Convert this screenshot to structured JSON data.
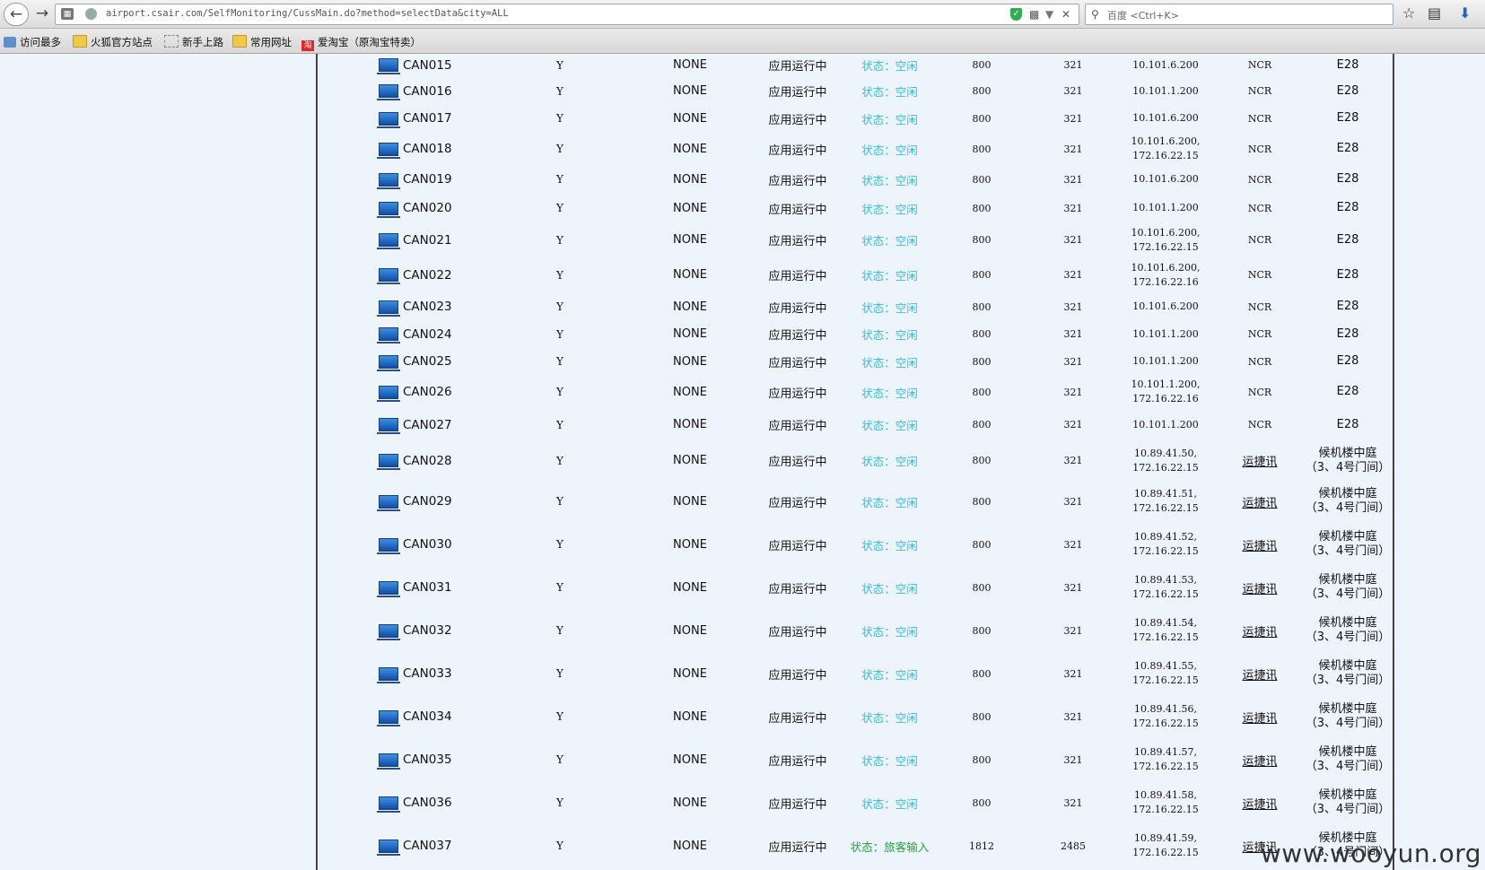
{
  "browser": {
    "url": "airport.csair.com/SelfMonitoring/CussMain.do?method=selectData&city=ALL",
    "search_placeholder": "百度 <Ctrl+K>"
  },
  "bookmarks": [
    "访问最多",
    "火狐官方站点",
    "新手上路",
    "常用网址",
    "爱淘宝（原淘宝特卖）"
  ],
  "rows": [
    {
      "name": "CAN015",
      "f1": "Y",
      "f2": "NONE",
      "app": "应用运行中",
      "status": "状态：空闲",
      "n1": "800",
      "n2": "321",
      "ip": [
        "10.101.6.200"
      ],
      "vendor": "NCR",
      "loc": [
        "E28"
      ]
    },
    {
      "name": "CAN016",
      "f1": "Y",
      "f2": "NONE",
      "app": "应用运行中",
      "status": "状态：空闲",
      "n1": "800",
      "n2": "321",
      "ip": [
        "10.101.1.200"
      ],
      "vendor": "NCR",
      "loc": [
        "E28"
      ]
    },
    {
      "name": "CAN017",
      "f1": "Y",
      "f2": "NONE",
      "app": "应用运行中",
      "status": "状态：空闲",
      "n1": "800",
      "n2": "321",
      "ip": [
        "10.101.6.200"
      ],
      "vendor": "NCR",
      "loc": [
        "E28"
      ]
    },
    {
      "name": "CAN018",
      "f1": "Y",
      "f2": "NONE",
      "app": "应用运行中",
      "status": "状态：空闲",
      "n1": "800",
      "n2": "321",
      "ip": [
        "10.101.6.200,",
        "172.16.22.15"
      ],
      "vendor": "NCR",
      "loc": [
        "E28"
      ]
    },
    {
      "name": "CAN019",
      "f1": "Y",
      "f2": "NONE",
      "app": "应用运行中",
      "status": "状态：空闲",
      "n1": "800",
      "n2": "321",
      "ip": [
        "10.101.6.200"
      ],
      "vendor": "NCR",
      "loc": [
        "E28"
      ]
    },
    {
      "name": "CAN020",
      "f1": "Y",
      "f2": "NONE",
      "app": "应用运行中",
      "status": "状态：空闲",
      "n1": "800",
      "n2": "321",
      "ip": [
        "10.101.1.200"
      ],
      "vendor": "NCR",
      "loc": [
        "E28"
      ]
    },
    {
      "name": "CAN021",
      "f1": "Y",
      "f2": "NONE",
      "app": "应用运行中",
      "status": "状态：空闲",
      "n1": "800",
      "n2": "321",
      "ip": [
        "10.101.6.200,",
        "172.16.22.15"
      ],
      "vendor": "NCR",
      "loc": [
        "E28"
      ]
    },
    {
      "name": "CAN022",
      "f1": "Y",
      "f2": "NONE",
      "app": "应用运行中",
      "status": "状态：空闲",
      "n1": "800",
      "n2": "321",
      "ip": [
        "10.101.6.200,",
        "172.16.22.16"
      ],
      "vendor": "NCR",
      "loc": [
        "E28"
      ]
    },
    {
      "name": "CAN023",
      "f1": "Y",
      "f2": "NONE",
      "app": "应用运行中",
      "status": "状态：空闲",
      "n1": "800",
      "n2": "321",
      "ip": [
        "10.101.6.200"
      ],
      "vendor": "NCR",
      "loc": [
        "E28"
      ]
    },
    {
      "name": "CAN024",
      "f1": "Y",
      "f2": "NONE",
      "app": "应用运行中",
      "status": "状态：空闲",
      "n1": "800",
      "n2": "321",
      "ip": [
        "10.101.1.200"
      ],
      "vendor": "NCR",
      "loc": [
        "E28"
      ]
    },
    {
      "name": "CAN025",
      "f1": "Y",
      "f2": "NONE",
      "app": "应用运行中",
      "status": "状态：空闲",
      "n1": "800",
      "n2": "321",
      "ip": [
        "10.101.1.200"
      ],
      "vendor": "NCR",
      "loc": [
        "E28"
      ]
    },
    {
      "name": "CAN026",
      "f1": "Y",
      "f2": "NONE",
      "app": "应用运行中",
      "status": "状态：空闲",
      "n1": "800",
      "n2": "321",
      "ip": [
        "10.101.1.200,",
        "172.16.22.16"
      ],
      "vendor": "NCR",
      "loc": [
        "E28"
      ]
    },
    {
      "name": "CAN027",
      "f1": "Y",
      "f2": "NONE",
      "app": "应用运行中",
      "status": "状态：空闲",
      "n1": "800",
      "n2": "321",
      "ip": [
        "10.101.1.200"
      ],
      "vendor": "NCR",
      "loc": [
        "E28"
      ]
    },
    {
      "name": "CAN028",
      "f1": "Y",
      "f2": "NONE",
      "app": "应用运行中",
      "status": "状态：空闲",
      "n1": "800",
      "n2": "321",
      "ip": [
        "10.89.41.50,",
        "172.16.22.15"
      ],
      "vendor": "运捷讯",
      "loc": [
        "候机楼中庭",
        "（3、4号门间）"
      ]
    },
    {
      "name": "CAN029",
      "f1": "Y",
      "f2": "NONE",
      "app": "应用运行中",
      "status": "状态：空闲",
      "n1": "800",
      "n2": "321",
      "ip": [
        "10.89.41.51,",
        "172.16.22.15"
      ],
      "vendor": "运捷讯",
      "loc": [
        "候机楼中庭",
        "（3、4号门间）"
      ]
    },
    {
      "name": "CAN030",
      "f1": "Y",
      "f2": "NONE",
      "app": "应用运行中",
      "status": "状态：空闲",
      "n1": "800",
      "n2": "321",
      "ip": [
        "10.89.41.52,",
        "172.16.22.15"
      ],
      "vendor": "运捷讯",
      "loc": [
        "候机楼中庭",
        "（3、4号门间）"
      ]
    },
    {
      "name": "CAN031",
      "f1": "Y",
      "f2": "NONE",
      "app": "应用运行中",
      "status": "状态：空闲",
      "n1": "800",
      "n2": "321",
      "ip": [
        "10.89.41.53,",
        "172.16.22.15"
      ],
      "vendor": "运捷讯",
      "loc": [
        "候机楼中庭",
        "（3、4号门间）"
      ]
    },
    {
      "name": "CAN032",
      "f1": "Y",
      "f2": "NONE",
      "app": "应用运行中",
      "status": "状态：空闲",
      "n1": "800",
      "n2": "321",
      "ip": [
        "10.89.41.54,",
        "172.16.22.15"
      ],
      "vendor": "运捷讯",
      "loc": [
        "候机楼中庭",
        "（3、4号门间）"
      ]
    },
    {
      "name": "CAN033",
      "f1": "Y",
      "f2": "NONE",
      "app": "应用运行中",
      "status": "状态：空闲",
      "n1": "800",
      "n2": "321",
      "ip": [
        "10.89.41.55,",
        "172.16.22.15"
      ],
      "vendor": "运捷讯",
      "loc": [
        "候机楼中庭",
        "（3、4号门间）"
      ]
    },
    {
      "name": "CAN034",
      "f1": "Y",
      "f2": "NONE",
      "app": "应用运行中",
      "status": "状态：空闲",
      "n1": "800",
      "n2": "321",
      "ip": [
        "10.89.41.56,",
        "172.16.22.15"
      ],
      "vendor": "运捷讯",
      "loc": [
        "候机楼中庭",
        "（3、4号门间）"
      ]
    },
    {
      "name": "CAN035",
      "f1": "Y",
      "f2": "NONE",
      "app": "应用运行中",
      "status": "状态：空闲",
      "n1": "800",
      "n2": "321",
      "ip": [
        "10.89.41.57,",
        "172.16.22.15"
      ],
      "vendor": "运捷讯",
      "loc": [
        "候机楼中庭",
        "（3、4号门间）"
      ]
    },
    {
      "name": "CAN036",
      "f1": "Y",
      "f2": "NONE",
      "app": "应用运行中",
      "status": "状态：空闲",
      "n1": "800",
      "n2": "321",
      "ip": [
        "10.89.41.58,",
        "172.16.22.15"
      ],
      "vendor": "运捷讯",
      "loc": [
        "候机楼中庭",
        "（3、4号门间）"
      ]
    },
    {
      "name": "CAN037",
      "f1": "Y",
      "f2": "NONE",
      "app": "应用运行中",
      "status": "状态：旅客输入",
      "n1": "1812",
      "n2": "2485",
      "ip": [
        "10.89.41.59,",
        "172.16.22.15"
      ],
      "vendor": "运捷讯",
      "loc": [
        "候机楼中庭",
        "（3、4号门间）"
      ]
    }
  ],
  "watermark": "www.wooyun.org"
}
